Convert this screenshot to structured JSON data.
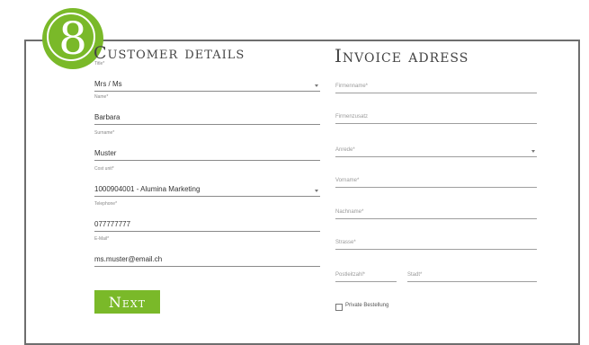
{
  "step": {
    "number": "8"
  },
  "customer_details": {
    "title": "Customer details",
    "fields": {
      "title": {
        "label": "Title*",
        "value": "Mrs / Ms"
      },
      "name": {
        "label": "Name*",
        "value": "Barbara"
      },
      "surname": {
        "label": "Surname*",
        "value": "Muster"
      },
      "cost_unit": {
        "label": "Cost unit*",
        "value": "1000904001 - Alumina Marketing"
      },
      "telephone": {
        "label": "Telephone*",
        "value": "077777777"
      },
      "email": {
        "label": "E-Mail*",
        "value": "ms.muster@email.ch"
      }
    },
    "next_label": "Next"
  },
  "invoice_address": {
    "title": "Invoice adress",
    "fields": {
      "firmenname": {
        "placeholder": "Firmenname*"
      },
      "firmenzusatz": {
        "placeholder": "Firmenzusatz"
      },
      "anrede": {
        "placeholder": "Anrede*"
      },
      "vorname": {
        "placeholder": "Vorname*"
      },
      "nachname": {
        "placeholder": "Nachname*"
      },
      "strasse": {
        "placeholder": "Strasse*"
      },
      "postleitzahl": {
        "placeholder": "Postleitzahl*"
      },
      "stadt": {
        "placeholder": "Stadt*"
      }
    },
    "private_checkbox": {
      "label": "Private Bestellung",
      "checked": false
    }
  },
  "colors": {
    "accent": "#7ab929",
    "frame": "#6e6e6e"
  },
  "icons": {
    "dropdown": "chevron-down-icon"
  }
}
